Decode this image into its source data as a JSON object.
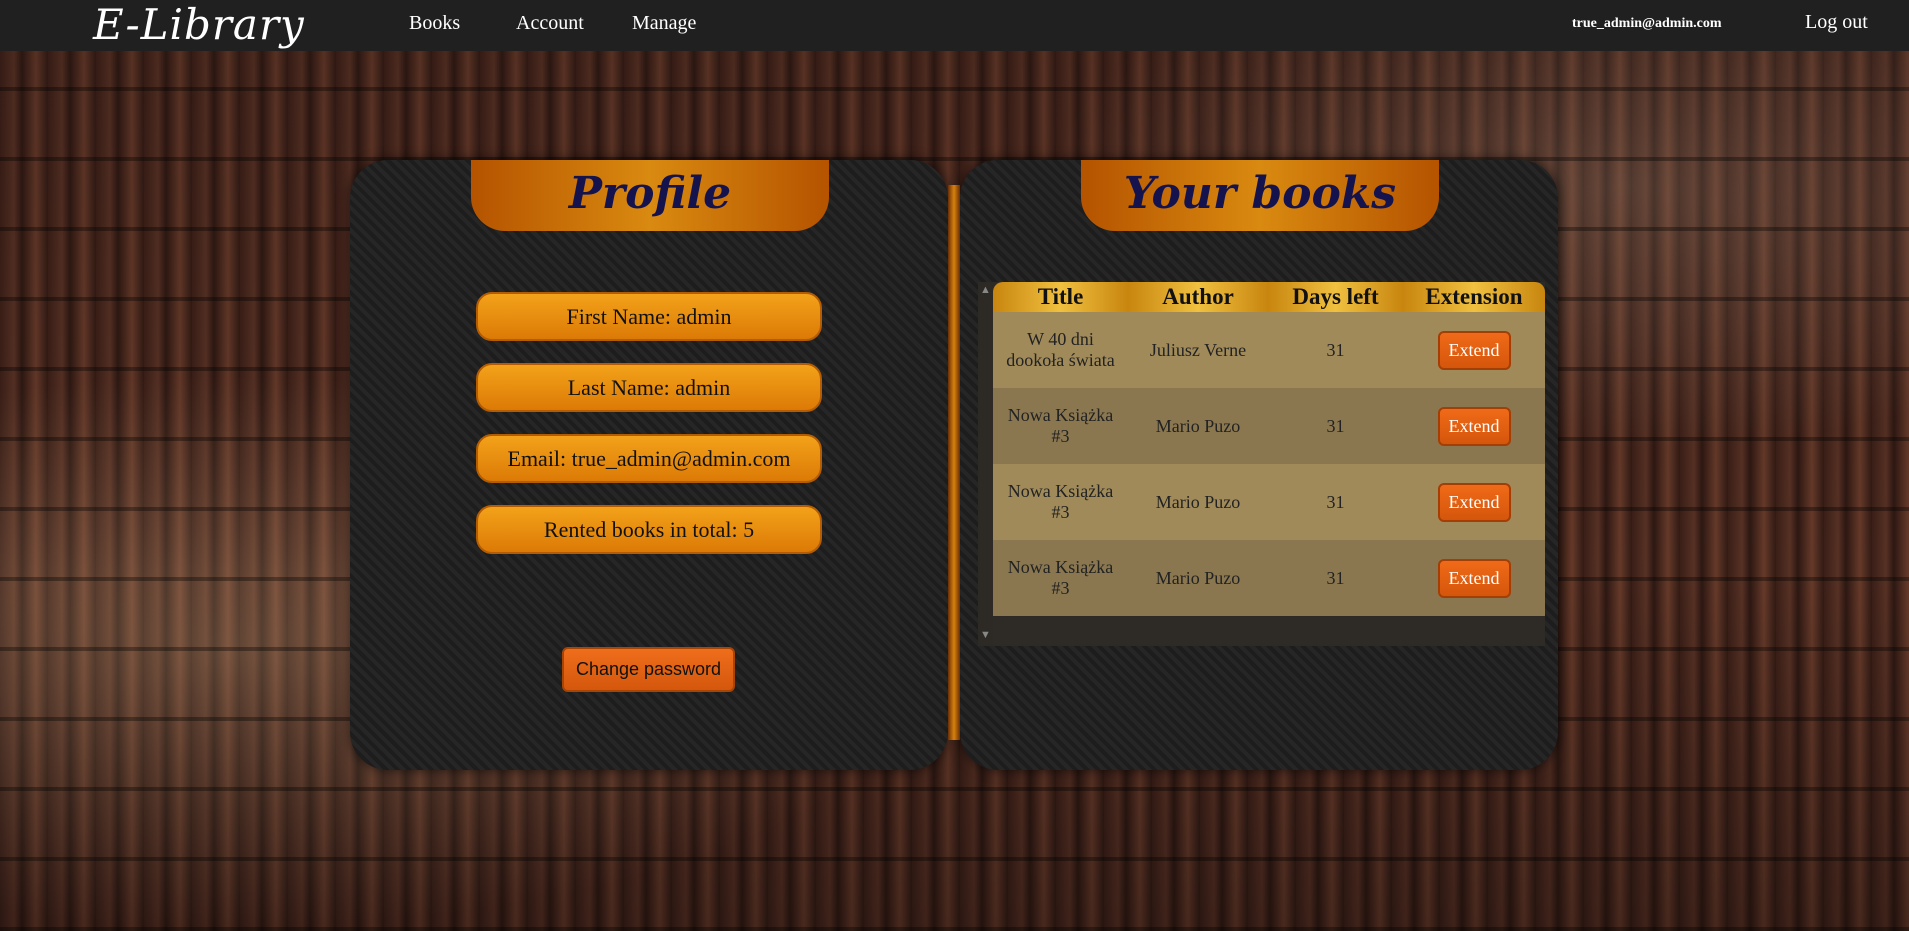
{
  "header": {
    "logo": "E-Library",
    "nav": [
      "Books",
      "Account",
      "Manage"
    ],
    "user_email": "true_admin@admin.com",
    "logout": "Log out"
  },
  "profile": {
    "title": "Profile",
    "first_name": "First Name: admin",
    "last_name": "Last Name: admin",
    "email": "Email: true_admin@admin.com",
    "rented_total": "Rented books in total: 5",
    "change_password": "Change password"
  },
  "books": {
    "title": "Your books",
    "columns": [
      "Title",
      "Author",
      "Days left",
      "Extension"
    ],
    "rows": [
      {
        "title": "W 40 dni dookoła świata",
        "author": "Juliusz Verne",
        "days_left": "31",
        "action": "Extend"
      },
      {
        "title": "Nowa Książka #3",
        "author": "Mario Puzo",
        "days_left": "31",
        "action": "Extend"
      },
      {
        "title": "Nowa Książka #3",
        "author": "Mario Puzo",
        "days_left": "31",
        "action": "Extend"
      },
      {
        "title": "Nowa Książka #3",
        "author": "Mario Puzo",
        "days_left": "31",
        "action": "Extend"
      }
    ]
  },
  "colors": {
    "accent_orange": "#e07b08",
    "title_text": "#14134e",
    "topbar": "#202020"
  }
}
